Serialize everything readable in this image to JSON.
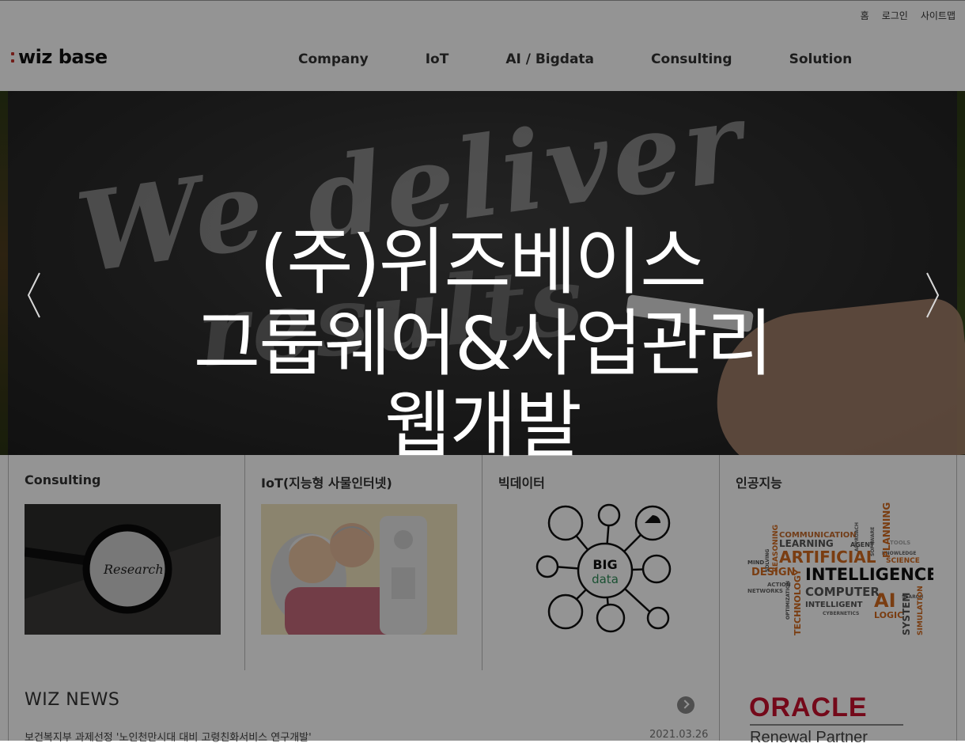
{
  "util_links": [
    "홈",
    "로그인",
    "사이트맵"
  ],
  "logo": {
    "text": "wiz base"
  },
  "nav": [
    "Company",
    "IoT",
    "AI / Bigdata",
    "Consulting",
    "Solution"
  ],
  "hero": {
    "line1": "(주)위즈베이스",
    "line2": "그룹웨어&사업관리",
    "line3": "웹개발",
    "chalk1": "We deliver",
    "chalk2": "results"
  },
  "cards": [
    {
      "title": "Consulting",
      "image_text": "Research"
    },
    {
      "title": "IoT(지능형 사물인터넷)"
    },
    {
      "title": "빅데이터",
      "image_text": "BIG data"
    },
    {
      "title": "인공지능",
      "words": [
        "ARTIFICIAL",
        "INTELLIGENCE",
        "COMPUTER",
        "AI",
        "LEARNING",
        "DESIGN",
        "TECHNOLOGY",
        "LOGIC",
        "SYSTEM",
        "SCIENCE",
        "RESEARCH",
        "AGENT",
        "INTELLIGENT",
        "COMMUNICATION",
        "PLANNING",
        "REASONING",
        "SIMULATION",
        "KNOWLEDGE",
        "ACTION",
        "TOOLS",
        "MIND",
        "NETWORKS",
        "SOLVING",
        "SEARCH",
        "OPTIMIZATION",
        "CYBERNETICS",
        "SOFTWARE",
        "APPROACH"
      ]
    }
  ],
  "news": {
    "title": "WIZ NEWS",
    "item": "보건복지부 과제선정 '노인천만시대 대비 고령친화서비스 연구개발'",
    "date": "2021.03.26"
  },
  "partner": {
    "name": "ORACLE",
    "sub": "Renewal Partner"
  },
  "colors": {
    "brand_red": "#c4322b",
    "oracle_red": "#c8102e",
    "overlay": "rgba(0,0,0,0.42)"
  },
  "icons": [
    "arrow-left-icon",
    "arrow-right-icon",
    "news-more-icon"
  ]
}
